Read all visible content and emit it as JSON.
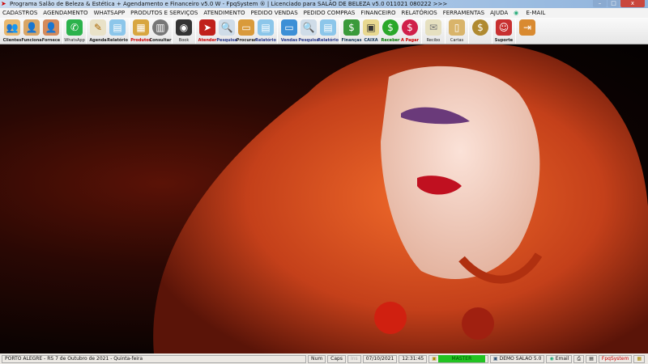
{
  "window": {
    "title": "Programa Salão de Beleza & Estética + Agendamento e Financeiro v5.0 W - FpqSystem ® | Licenciado para  SALÃO DE BELEZA v5.0 011021 080222 >>>",
    "minimize": "–",
    "maximize": "□",
    "close": "x"
  },
  "menu": [
    "CADASTROS",
    "AGENDAMENTO",
    "WHATSAPP",
    "PRODUTOS E SERVIÇOS",
    "ATENDIMENTO",
    "PEDIDO VENDAS",
    "PEDIDO COMPRAS",
    "FINANCEIRO",
    "RELATÓRIOS",
    "FERRAMENTAS",
    "AJUDA",
    "E-MAIL"
  ],
  "toolbar": {
    "clientes": "Clientes",
    "funciona": "Funciona",
    "fornece": "Fornece",
    "whatsapp": "WhatsApp",
    "agenda": "Agenda",
    "relatorio1": "Relatório",
    "produtos": "Produtos",
    "consultar": "Consultar",
    "book": "Book",
    "atender": "Atender",
    "pesquisa1": "Pesquisa",
    "procurar": "Procurar",
    "relatorio2": "Relatório",
    "vendas": "Vendas",
    "pesquisa2": "Pesquisa",
    "relatorio3": "Relatório",
    "financas": "Finanças",
    "caixa": "CAIXA",
    "receber": "Receber",
    "apagar": "A Pagar",
    "recibo": "Recibo",
    "cartas": "Cartas",
    "suporte": "Suporte"
  },
  "status": {
    "location": "PORTO ALEGRE - RS  7 de Outubro de 2021 - Quinta-feira",
    "num": "Num",
    "caps": "Caps",
    "ins": "Ins",
    "date": "07/10/2021",
    "time": "12:31:45",
    "user": "MASTER",
    "version": "DEMO SALAO 5.0",
    "email": "Email",
    "brand": "FpqSystem"
  },
  "colors": {
    "master_bg": "#22c322",
    "brand": "#cc0000"
  }
}
